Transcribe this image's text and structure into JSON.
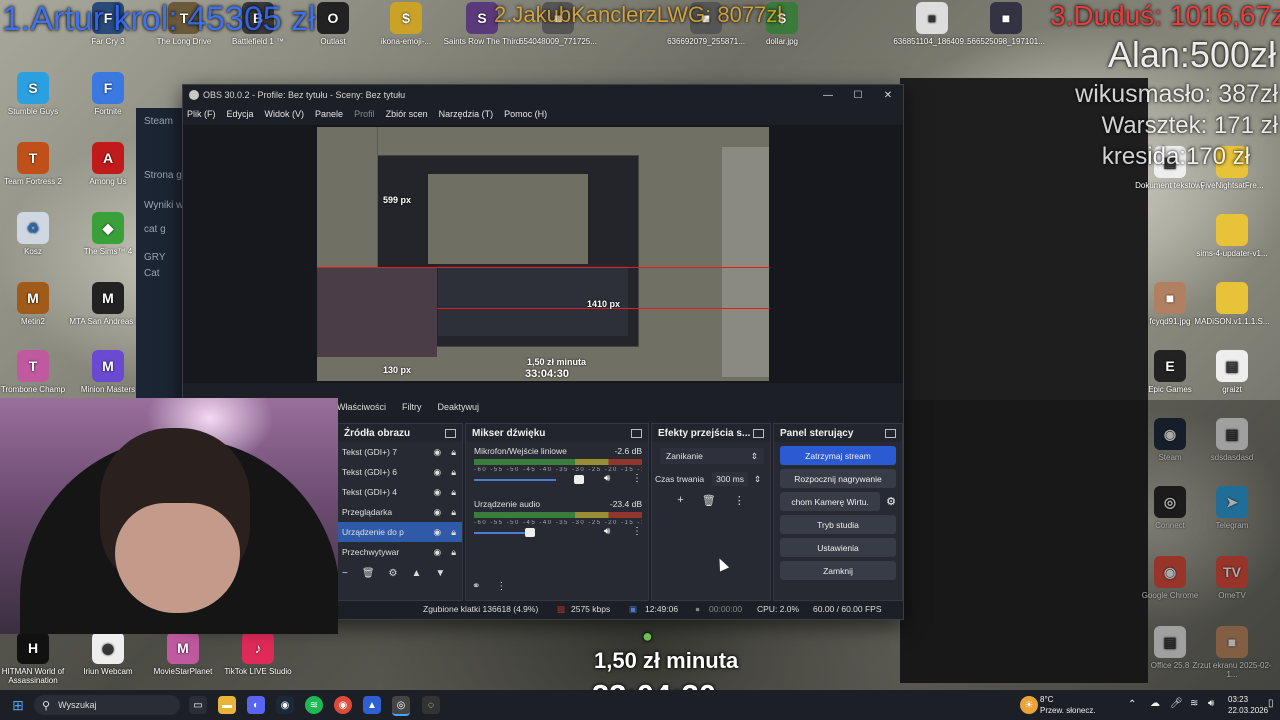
{
  "overlays": {
    "donor1": "1.Artur krol: 45305 zł",
    "donor2": "2.JakubKanclerzLWG: 8077zł",
    "donor3": "3.Duduś: 1016,67zł",
    "board": [
      "Alan:500zł",
      "wikusmasło: 387zł",
      "Warsztek: 171 zł",
      "kresida:170 zł"
    ],
    "rate": "1,50 zł minuta",
    "timer": "33:04:30"
  },
  "desktop_icons": [
    {
      "label": "Far Cry 3",
      "color": "#2a4a7a",
      "glyph": "F"
    },
    {
      "label": "The Long Drive",
      "color": "#6a5a3a",
      "glyph": "T"
    },
    {
      "label": "Battlefield 1 ™",
      "color": "#3a3a3a",
      "glyph": "B"
    },
    {
      "label": "Outlast",
      "color": "#222",
      "glyph": "O"
    },
    {
      "label": "ikona-emoji-...",
      "color": "#c9a227",
      "glyph": "$"
    },
    {
      "label": "Saints Row The Third",
      "color": "#5a3a7a",
      "glyph": "S"
    },
    {
      "label": "654048009_771725...",
      "color": "#555",
      "glyph": "■"
    },
    {
      "label": "dollar.jpg",
      "color": "#3a7a3a",
      "glyph": "$"
    },
    {
      "label": "636692079_255871...",
      "color": "#555",
      "glyph": "■"
    },
    {
      "label": "636851104_186409...",
      "color": "#ddd",
      "glyph": "■"
    },
    {
      "label": "566525098_197101...",
      "color": "#334",
      "glyph": "■"
    },
    {
      "label": "Stumble Guys",
      "color": "#2aa0e0",
      "glyph": "S"
    },
    {
      "label": "Fortnite",
      "color": "#3a7ae0",
      "glyph": "F"
    },
    {
      "label": "Team Fortress 2",
      "color": "#c0501a",
      "glyph": "T"
    },
    {
      "label": "Among Us",
      "color": "#c01a1a",
      "glyph": "A"
    },
    {
      "label": "Kosz",
      "color": "#cfd8e0",
      "glyph": "♻"
    },
    {
      "label": "The Sims™ 4",
      "color": "#3aa03a",
      "glyph": "◆"
    },
    {
      "label": "Metin2",
      "color": "#a05a1a",
      "glyph": "M"
    },
    {
      "label": "MTA San Andreas 1.6",
      "color": "#222",
      "glyph": "M"
    },
    {
      "label": "Trombone Champ",
      "color": "#c05aa0",
      "glyph": "T"
    },
    {
      "label": "Minion Masters",
      "color": "#6a4ad0",
      "glyph": "M"
    },
    {
      "label": "HITMAN World of Assassination",
      "color": "#111",
      "glyph": "H"
    },
    {
      "label": "Iriun Webcam",
      "color": "#eee",
      "glyph": "◉"
    },
    {
      "label": "MovieStarPlanet",
      "color": "#c05aa0",
      "glyph": "M"
    },
    {
      "label": "TikTok LIVE Studio",
      "color": "#e02a5a",
      "glyph": "♪"
    }
  ],
  "right_icons": [
    {
      "label": "Dokument tekstowy",
      "color": "#eee"
    },
    {
      "label": "FiveNightsatFre...",
      "color": "#e8c33a"
    },
    {
      "label": "sims-4-updater-v1...",
      "color": "#e8c33a"
    },
    {
      "label": "fcyqd91.jpg",
      "color": "#b08060"
    },
    {
      "label": "MADiSON.v1.1.1.S...",
      "color": "#e8c33a"
    },
    {
      "label": "Epic Games",
      "color": "#222"
    },
    {
      "label": "graizt",
      "color": "#eee"
    },
    {
      "label": "Steam",
      "color": "#1b2838"
    },
    {
      "label": "sdsdasdasd",
      "color": "#eee"
    },
    {
      "label": "Connect",
      "color": "#222"
    },
    {
      "label": "Telegram",
      "color": "#2aa0e0"
    },
    {
      "label": "Google Chrome",
      "color": "#e04a3a"
    },
    {
      "label": "OmeTV",
      "color": "#e04a3a"
    },
    {
      "label": "Office 25.8",
      "color": "#eee"
    },
    {
      "label": "Zrzut ekranu 2025-02-1...",
      "color": "#c08a60"
    }
  ],
  "bg_window": {
    "title": "Steam",
    "item1": "Strona gł",
    "item2": "Wyniki w",
    "item3": "cat g",
    "item4": "GRY",
    "item5": "Cat"
  },
  "obs": {
    "title": "OBS 30.0.2 - Profile: Bez tytułu - Sceny: Bez tytułu",
    "menu": [
      "Plik (F)",
      "Edycja",
      "Widok (V)",
      "Panele",
      "Profil",
      "Zbiór scen",
      "Narzędzia (T)",
      "Pomoc (H)"
    ],
    "preview": {
      "label_a": "599 px",
      "label_b": "1410 px",
      "label_c": "130 px",
      "rate": "1,50 zł minuta",
      "timer": "33:04:30"
    },
    "context": [
      "Właściwości",
      "Filtry",
      "Deaktywuj"
    ],
    "sources_title": "Źródła obrazu",
    "sources": [
      {
        "name": "Tekst (GDI+) 7",
        "selected": false
      },
      {
        "name": "Tekst (GDI+) 6",
        "selected": false
      },
      {
        "name": "Tekst (GDI+) 4",
        "selected": false
      },
      {
        "name": "Przeglądarka",
        "selected": false
      },
      {
        "name": "Urządzenie do p",
        "selected": true
      },
      {
        "name": "Przechwytywar",
        "selected": false
      }
    ],
    "mixer_title": "Mikser dźwięku",
    "mixer": [
      {
        "name": "Mikrofon/Wejście liniowe",
        "db": "-2.6 dB",
        "level": 0.78
      },
      {
        "name": "Urządzenie audio",
        "db": "-23.4 dB",
        "level": 0.43
      }
    ],
    "mixer_ticks": "-60 -55 -50 -45 -40 -35 -30 -25 -20 -15 -10 -5 0",
    "transitions_title": "Efekty przejścia s...",
    "transition": "Zanikanie",
    "duration_label": "Czas trwania",
    "duration_value": "300 ms",
    "controls_title": "Panel sterujący",
    "controls": [
      "Zatrzymaj stream",
      "Rozpocznij nagrywanie",
      "chom Kamerę Wirtu.",
      "Tryb studia",
      "Ustawienia",
      "Zamknij"
    ],
    "status": {
      "dropped": "Zgubione klatki 136618 (4.9%)",
      "kbps": "2575 kbps",
      "stream_time": "12:49:06",
      "rec_time": "00:00:00",
      "cpu": "CPU: 2.0%",
      "fps": "60.00 / 60.00 FPS"
    }
  },
  "taskbar": {
    "search_placeholder": "Wyszukaj",
    "weather_temp": "8°C",
    "weather_desc": "Przew. słonecz.",
    "time": "03:23",
    "date": "22.03.2026"
  }
}
